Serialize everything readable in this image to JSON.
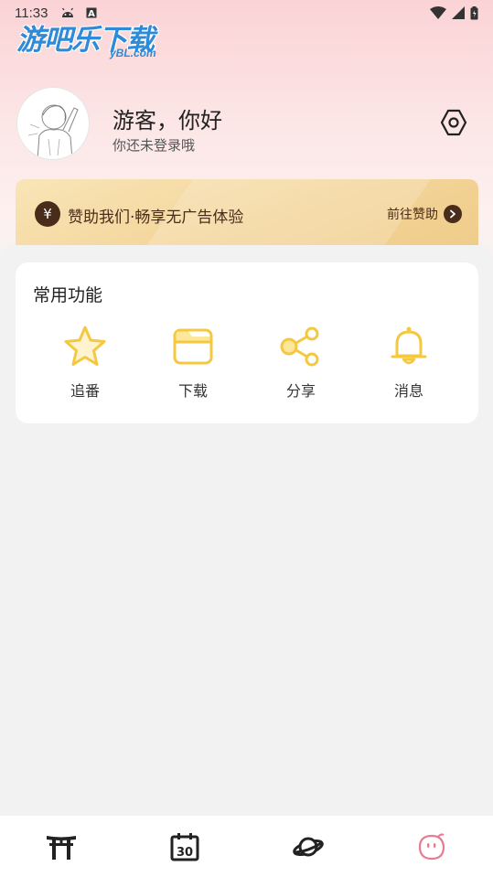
{
  "status_bar": {
    "time": "11:33",
    "notif_icons": [
      "android-icon",
      "a-badge-icon"
    ],
    "right_icons": [
      "wifi-icon",
      "signal-icon",
      "battery-icon"
    ]
  },
  "watermark": {
    "title": "游吧乐下载",
    "subtitle": "yBL.com"
  },
  "profile": {
    "greeting": "游客，你好",
    "hint": "你还未登录哦"
  },
  "sponsor": {
    "coin": "¥",
    "text": "赞助我们·畅享无广告体验",
    "link": "前往赞助"
  },
  "functions": {
    "title": "常用功能",
    "items": [
      {
        "label": "追番",
        "icon": "star-icon"
      },
      {
        "label": "下载",
        "icon": "folder-icon"
      },
      {
        "label": "分享",
        "icon": "share-icon"
      },
      {
        "label": "消息",
        "icon": "bell-icon"
      }
    ]
  },
  "bottom_nav": {
    "items": [
      {
        "icon": "torii-icon",
        "active": false
      },
      {
        "icon": "calendar-30-icon",
        "active": false,
        "text": "30"
      },
      {
        "icon": "planet-icon",
        "active": false
      },
      {
        "icon": "mascot-face-icon",
        "active": true
      }
    ]
  },
  "colors": {
    "accent_yellow": "#f5c842",
    "accent_pink": "#e87a94",
    "sponsor_dark": "#4a2c1a",
    "watermark_blue": "#2f8ad8"
  }
}
